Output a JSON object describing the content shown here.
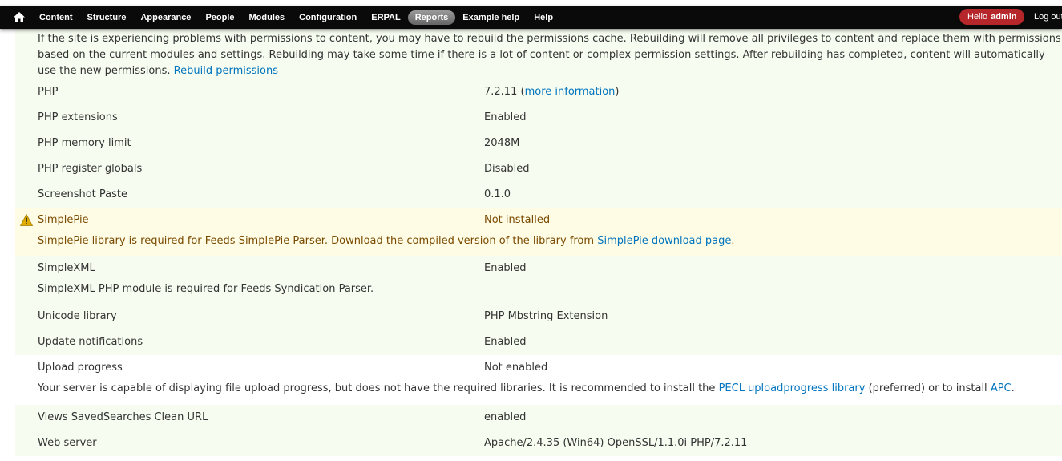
{
  "toolbar": {
    "home_icon": "home-icon",
    "menu": [
      "Content",
      "Structure",
      "Appearance",
      "People",
      "Modules",
      "Configuration",
      "ERPAL",
      "Reports",
      "Example help",
      "Help"
    ],
    "active_item": "Reports",
    "greeting": "Hello",
    "username": "admin",
    "logout": "Log out"
  },
  "intro": {
    "text": "If the site is experiencing problems with permissions to content, you may have to rebuild the permissions cache. Rebuilding will remove all privileges to content and replace them with permissions based on the current modules and settings. Rebuilding may take some time if there is a lot of content or complex permission settings. After rebuilding has completed, content will automatically use the new permissions.",
    "link": "Rebuild permissions"
  },
  "rows": {
    "php": {
      "title": "PHP",
      "value": "7.2.11",
      "link": "more information"
    },
    "php_extensions": {
      "title": "PHP extensions",
      "value": "Enabled"
    },
    "php_memory": {
      "title": "PHP memory limit",
      "value": "2048M"
    },
    "php_globals": {
      "title": "PHP register globals",
      "value": "Disabled"
    },
    "screenshot_paste": {
      "title": "Screenshot Paste",
      "value": "0.1.0"
    },
    "simplepie": {
      "title": "SimplePie",
      "value": "Not installed",
      "status_icon": "warning-icon",
      "desc": "SimplePie library is required for Feeds SimplePie Parser. Download the compiled version of the library from",
      "link": "SimplePie download page",
      "desc_end": "."
    },
    "simplexml": {
      "title": "SimpleXML",
      "value": "Enabled",
      "desc": "SimpleXML PHP module is required for Feeds Syndication Parser."
    },
    "unicode": {
      "title": "Unicode library",
      "value": "PHP Mbstring Extension"
    },
    "update_notifications": {
      "title": "Update notifications",
      "value": "Enabled"
    },
    "upload_progress": {
      "title": "Upload progress",
      "value": "Not enabled",
      "desc": "Your server is capable of displaying file upload progress, but does not have the required libraries. It is recommended to install the",
      "link1": "PECL uploadprogress library",
      "mid": "(preferred) or to install",
      "link2": "APC",
      "desc_end": "."
    },
    "views_clean_url": {
      "title": "Views SavedSearches Clean URL",
      "value": "enabled"
    },
    "web_server": {
      "title": "Web server",
      "value": "Apache/2.4.35 (Win64) OpenSSL/1.1.0i PHP/7.2.11"
    }
  },
  "colors": {
    "ok_bg": "#f7fcf0",
    "warning_bg": "#fffce5",
    "link": "#0074bd",
    "toolbar_bg": "#0a0a0a",
    "user_badge": "#b5272a"
  }
}
